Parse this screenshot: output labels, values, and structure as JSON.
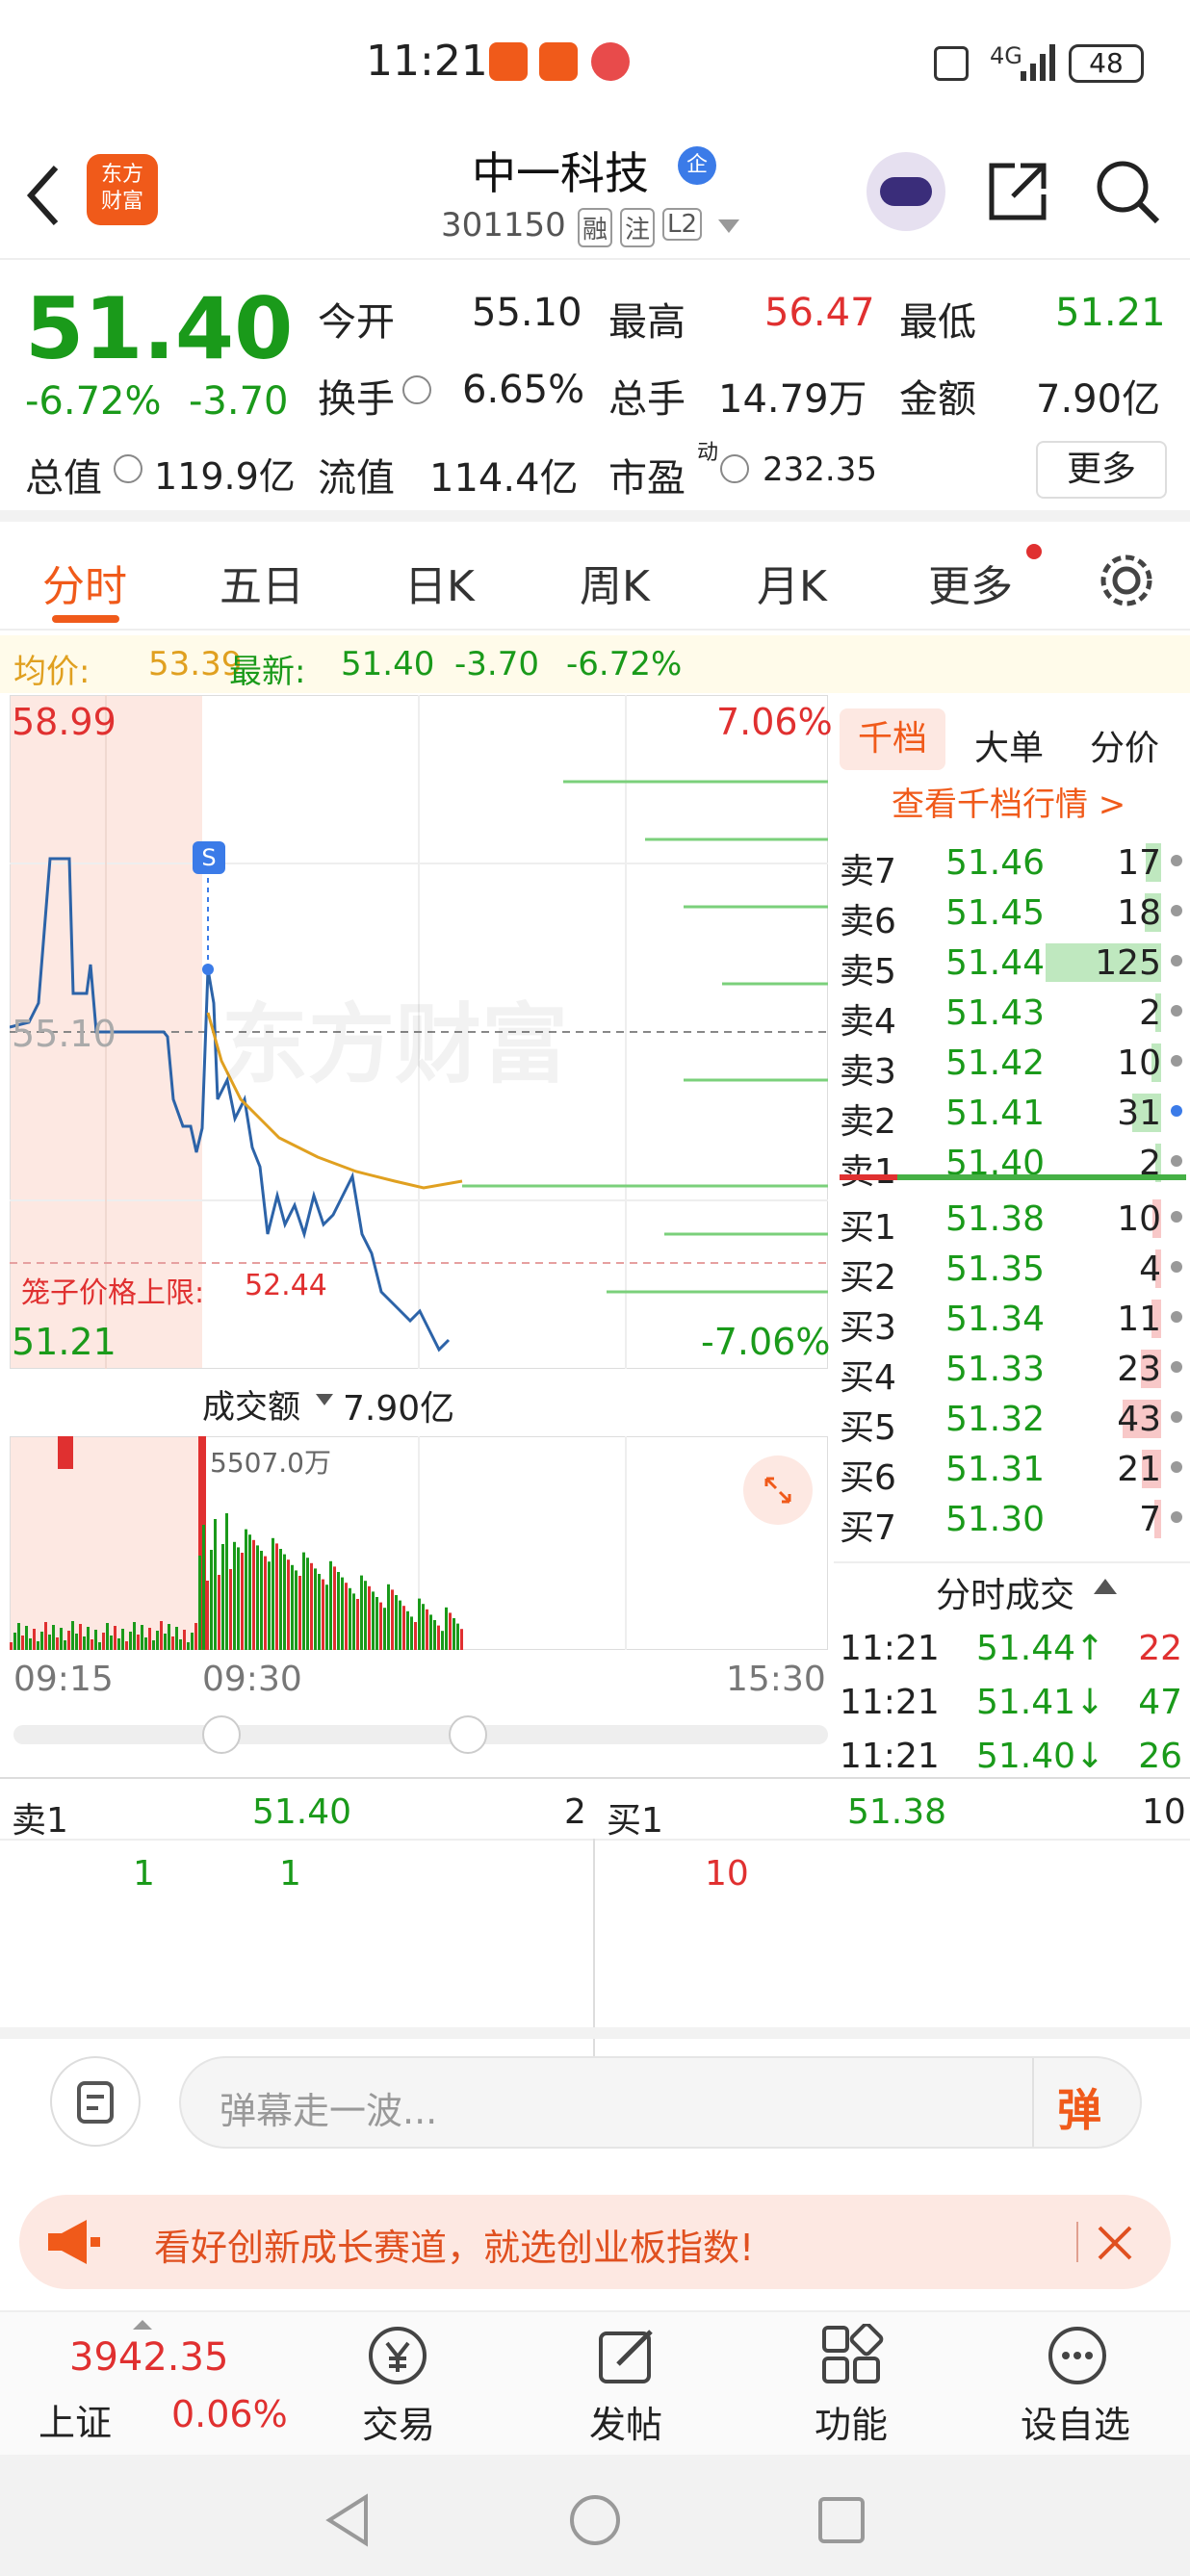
{
  "status_bar": {
    "time": "11:21",
    "network": "4G",
    "battery": "48"
  },
  "header": {
    "logo_line1": "东方",
    "logo_line2": "财富",
    "stock_name": "中一科技",
    "badge": "企",
    "code": "301150",
    "tag1": "融",
    "tag2": "注",
    "tag3": "L2"
  },
  "quote": {
    "price": "51.40",
    "change_pct": "-6.72%",
    "change": "-3.70",
    "open_label": "今开",
    "open": "55.10",
    "high_label": "最高",
    "high": "56.47",
    "low_label": "最低",
    "low": "51.21",
    "turnover_label": "换手",
    "turnover": "6.65%",
    "vol_label": "总手",
    "vol": "14.79万",
    "amount_label": "金额",
    "amount": "7.90亿",
    "mktcap_label": "总值",
    "mktcap": "119.9亿",
    "float_label": "流值",
    "float_cap": "114.4亿",
    "pe_label": "市盈",
    "pe_sup": "动",
    "pe": "232.35",
    "more_btn": "更多"
  },
  "tabs": [
    "分时",
    "五日",
    "日K",
    "周K",
    "月K",
    "更多"
  ],
  "infobar": {
    "avg_label": "均价:",
    "avg": "53.39",
    "latest_label": "最新:",
    "latest": "51.40",
    "chg": "-3.70",
    "pct": "-6.72%"
  },
  "chart": {
    "top_price": "58.99",
    "top_pct": "7.06%",
    "mid_price": "55.10",
    "bottom_price": "51.21",
    "bottom_pct": "-7.06%",
    "cage_label": "笼子价格上限:",
    "cage_value": "52.44",
    "watermark": "东方财富",
    "s_marker": "S",
    "vol_label": "成交额",
    "vol_value": "7.90亿",
    "vol_peak": "5507.0万",
    "time_start": "09:15",
    "time_mid": "09:30",
    "time_end": "15:30"
  },
  "book": {
    "tab1": "千档",
    "tab2": "大单",
    "tab3": "分价",
    "link": "查看千档行情 >",
    "asks": [
      {
        "label": "卖7",
        "price": "51.46",
        "vol": "17"
      },
      {
        "label": "卖6",
        "price": "51.45",
        "vol": "18"
      },
      {
        "label": "卖5",
        "price": "51.44",
        "vol": "125"
      },
      {
        "label": "卖4",
        "price": "51.43",
        "vol": "2"
      },
      {
        "label": "卖3",
        "price": "51.42",
        "vol": "10"
      },
      {
        "label": "卖2",
        "price": "51.41",
        "vol": "31"
      },
      {
        "label": "卖1",
        "price": "51.40",
        "vol": "2"
      }
    ],
    "bids": [
      {
        "label": "买1",
        "price": "51.38",
        "vol": "10"
      },
      {
        "label": "买2",
        "price": "51.35",
        "vol": "4"
      },
      {
        "label": "买3",
        "price": "51.34",
        "vol": "11"
      },
      {
        "label": "买4",
        "price": "51.33",
        "vol": "23"
      },
      {
        "label": "买5",
        "price": "51.32",
        "vol": "43"
      },
      {
        "label": "买6",
        "price": "51.31",
        "vol": "21"
      },
      {
        "label": "买7",
        "price": "51.30",
        "vol": "7"
      }
    ],
    "trades_title": "分时成交",
    "trades": [
      {
        "time": "11:21",
        "price": "51.44↑",
        "vol": "22"
      },
      {
        "time": "11:21",
        "price": "51.41↓",
        "vol": "47"
      },
      {
        "time": "11:21",
        "price": "51.40↓",
        "vol": "26"
      }
    ]
  },
  "level1": {
    "sell_label": "卖1",
    "sell_price": "51.40",
    "sell_vol": "2",
    "buy_label": "买1",
    "buy_price": "51.38",
    "buy_vol": "10",
    "q1": "1",
    "q2": "1",
    "q3": "10"
  },
  "danmu": {
    "placeholder": "弹幕走一波...",
    "btn": "弹"
  },
  "banner": {
    "text": "看好创新成长赛道，就选创业板指数!"
  },
  "bottom": {
    "index_value": "3942.35",
    "index_name": "上证",
    "index_pct": "0.06%",
    "trade": "交易",
    "post": "发帖",
    "func": "功能",
    "watch": "设自选"
  }
}
